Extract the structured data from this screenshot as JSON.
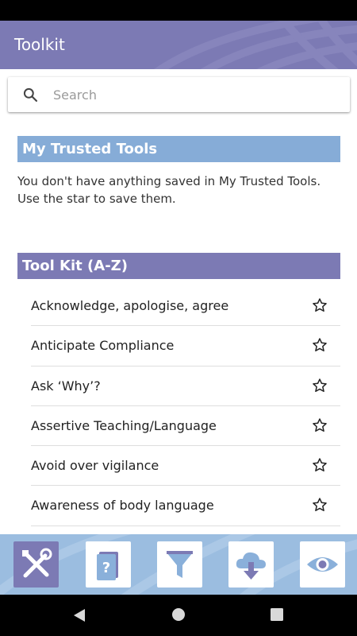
{
  "app_bar": {
    "title": "Toolkit"
  },
  "search": {
    "placeholder": "Search",
    "icon": "search-icon"
  },
  "trusted": {
    "header": "My Trusted Tools",
    "empty_message": "You don't have anything saved in My Trusted Tools. Use the star to save them."
  },
  "toolkit": {
    "header": "Tool Kit (A-Z)",
    "items": [
      {
        "label": "Acknowledge, apologise, agree"
      },
      {
        "label": "Anticipate Compliance"
      },
      {
        "label": "Ask ‘Why’?"
      },
      {
        "label": "Assertive Teaching/Language"
      },
      {
        "label": "Avoid over vigilance"
      },
      {
        "label": "Awareness of body language"
      },
      {
        "label": ""
      }
    ]
  },
  "bottom_nav": [
    {
      "name": "tools-icon",
      "active": true
    },
    {
      "name": "help-book-icon",
      "active": false
    },
    {
      "name": "filter-icon",
      "active": false
    },
    {
      "name": "cloud-download-icon",
      "active": false
    },
    {
      "name": "eye-icon",
      "active": false
    }
  ],
  "colors": {
    "primary": "#7c7ab4",
    "trusted_header": "#86acd7",
    "nav_background": "#9bbde0"
  }
}
